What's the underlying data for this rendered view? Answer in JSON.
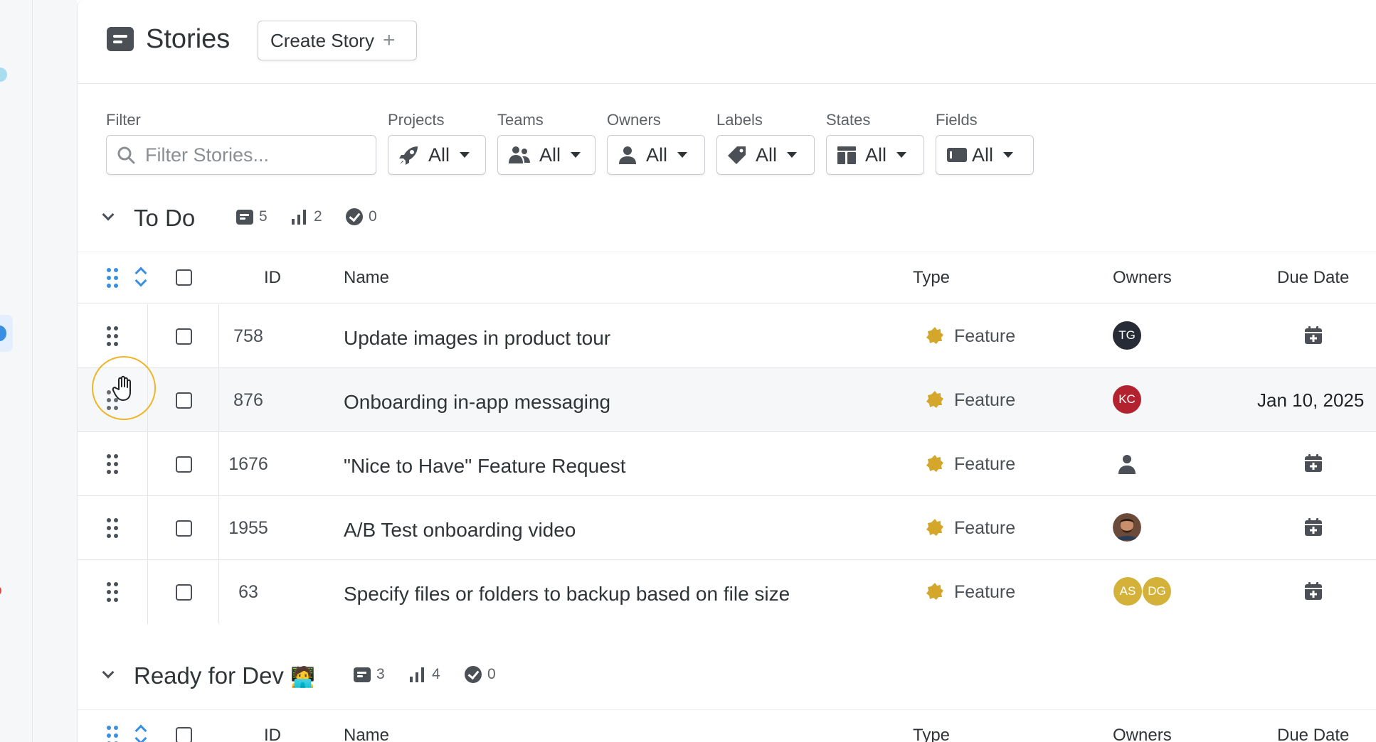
{
  "header": {
    "title": "Stories",
    "create_label": "Create Story",
    "create_plus": "+"
  },
  "filters": {
    "filter_label": "Filter",
    "search_placeholder": "Filter Stories...",
    "dropdowns": [
      {
        "label": "Projects",
        "value": "All",
        "icon": "rocket-icon"
      },
      {
        "label": "Teams",
        "value": "All",
        "icon": "users-icon"
      },
      {
        "label": "Owners",
        "value": "All",
        "icon": "user-icon"
      },
      {
        "label": "Labels",
        "value": "All",
        "icon": "tag-icon"
      },
      {
        "label": "States",
        "value": "All",
        "icon": "columns-icon"
      },
      {
        "label": "Fields",
        "value": "All",
        "icon": "field-icon"
      }
    ]
  },
  "columns": {
    "id": "ID",
    "name": "Name",
    "type": "Type",
    "owners": "Owners",
    "due_date": "Due Date"
  },
  "sections": [
    {
      "title": "To Do",
      "stats": {
        "stories": "5",
        "estimate": "2",
        "done": "0"
      },
      "rows": [
        {
          "id": "758",
          "name": "Update images in product tour",
          "type": "Feature",
          "owners": [
            "TG"
          ],
          "due": ""
        },
        {
          "id": "876",
          "name": "Onboarding in-app messaging",
          "type": "Feature",
          "owners": [
            "KC"
          ],
          "due": "Jan 10, 2025"
        },
        {
          "id": "1676",
          "name": "\"Nice to Have\" Feature Request",
          "type": "Feature",
          "owners": [],
          "due": ""
        },
        {
          "id": "1955",
          "name": "A/B Test onboarding video",
          "type": "Feature",
          "owners": [
            "photo"
          ],
          "due": ""
        },
        {
          "id": "63",
          "name": "Specify files or folders to backup based on file size",
          "type": "Feature",
          "owners": [
            "AS",
            "DG"
          ],
          "due": ""
        }
      ]
    },
    {
      "title": "Ready for Dev",
      "title_emoji": "🧑‍💻",
      "stats": {
        "stories": "3",
        "estimate": "4",
        "done": "0"
      }
    }
  ],
  "colors": {
    "accent_blue": "#3b8fe0",
    "feature_yellow": "#d4a62a",
    "avatar_tg": "#262b36",
    "avatar_kc": "#b2232f",
    "avatar_as": "#d4b23a",
    "avatar_dg": "#d4b23a",
    "cursor_ring": "#f0b429"
  }
}
